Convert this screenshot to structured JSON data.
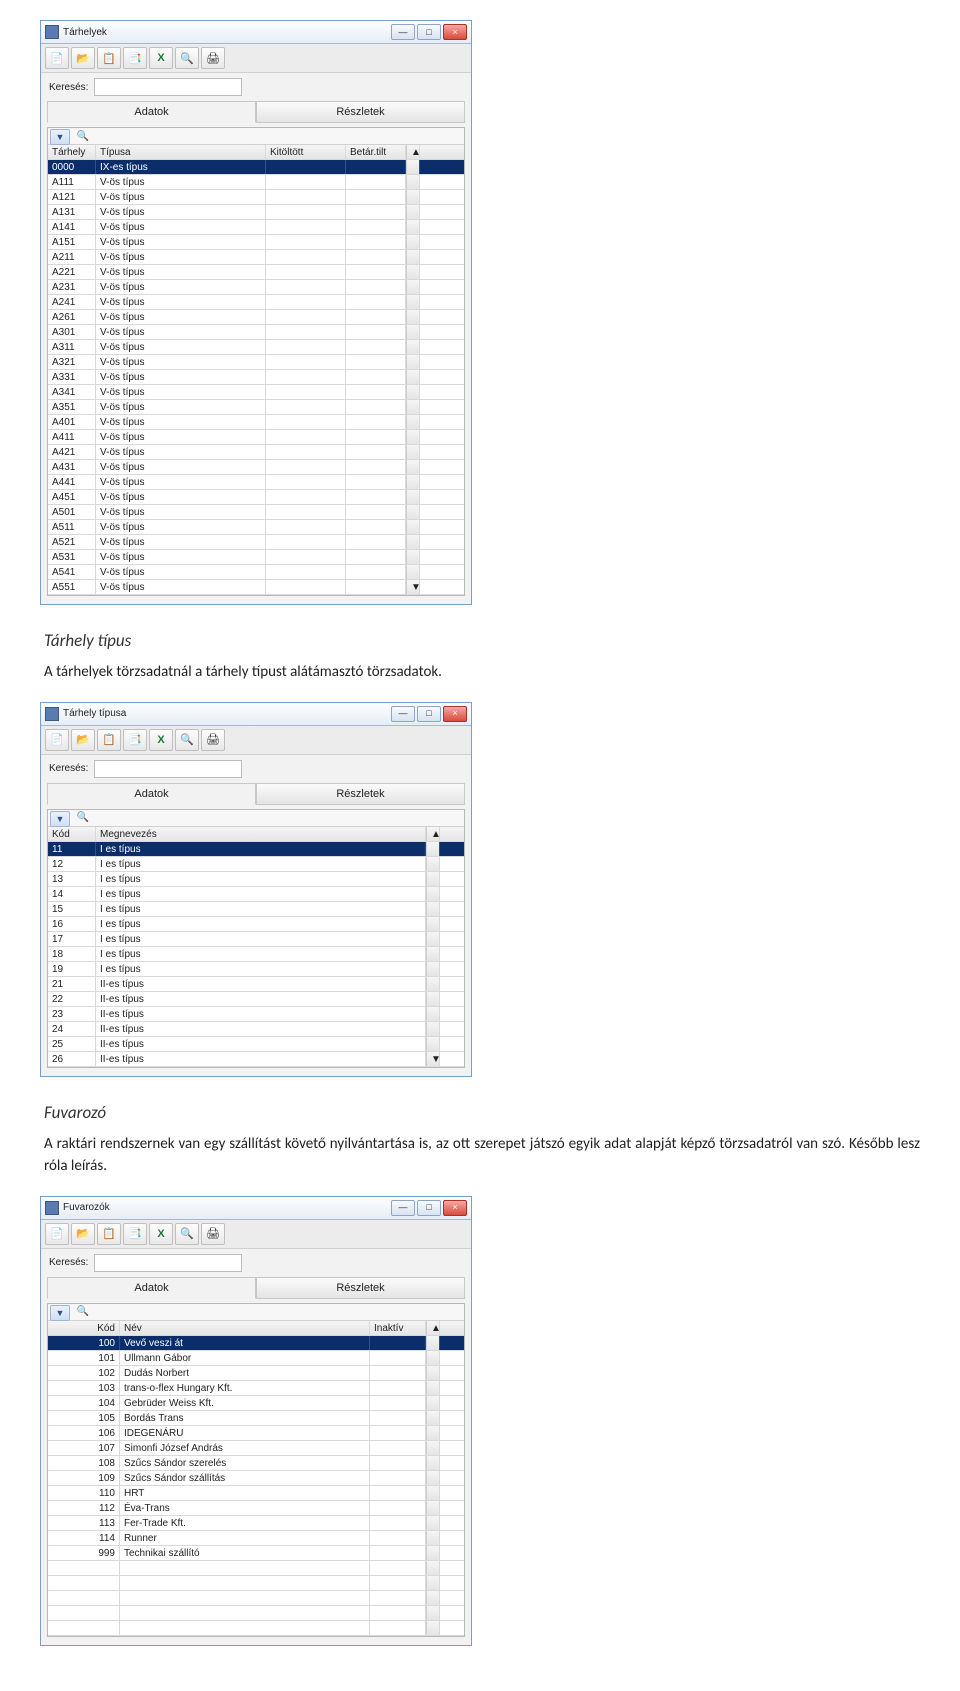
{
  "section1": {
    "heading": "Tárhely típus",
    "body": "A tárhelyek törzsadatnál a tárhely típust alátámasztó törzsadatok."
  },
  "section2": {
    "heading": "Fuvarozó",
    "body": "A raktári rendszernek van egy szállítást követő nyilvántartása is, az ott szerepet játszó egyik adat alapját képző törzsadatról van szó. Később lesz róla leírás."
  },
  "common": {
    "search_label": "Keresés:",
    "tab_data": "Adatok",
    "tab_details": "Részletek",
    "min_sym": "—",
    "max_sym": "□",
    "close_sym": "×",
    "filter_sym": "▼",
    "scroll_up": "▲",
    "scroll_down": "▼"
  },
  "win1": {
    "title": "Tárhelyek",
    "columns": {
      "c1": "Tárhely",
      "c2": "Típusa",
      "c3": "Kitöltött",
      "c4": "Betár.tilt"
    },
    "rows": [
      {
        "c1": "0000",
        "c2": "IX-es típus",
        "sel": true
      },
      {
        "c1": "A111",
        "c2": "V-ös típus"
      },
      {
        "c1": "A121",
        "c2": "V-ös típus"
      },
      {
        "c1": "A131",
        "c2": "V-ös típus"
      },
      {
        "c1": "A141",
        "c2": "V-ös típus"
      },
      {
        "c1": "A151",
        "c2": "V-ös típus"
      },
      {
        "c1": "A211",
        "c2": "V-ös típus"
      },
      {
        "c1": "A221",
        "c2": "V-ös típus"
      },
      {
        "c1": "A231",
        "c2": "V-ös típus"
      },
      {
        "c1": "A241",
        "c2": "V-ös típus"
      },
      {
        "c1": "A261",
        "c2": "V-ös típus"
      },
      {
        "c1": "A301",
        "c2": "V-ös típus"
      },
      {
        "c1": "A311",
        "c2": "V-ös típus"
      },
      {
        "c1": "A321",
        "c2": "V-ös típus"
      },
      {
        "c1": "A331",
        "c2": "V-ös típus"
      },
      {
        "c1": "A341",
        "c2": "V-ös típus"
      },
      {
        "c1": "A351",
        "c2": "V-ös típus"
      },
      {
        "c1": "A401",
        "c2": "V-ös típus"
      },
      {
        "c1": "A411",
        "c2": "V-ös típus"
      },
      {
        "c1": "A421",
        "c2": "V-ös típus"
      },
      {
        "c1": "A431",
        "c2": "V-ös típus"
      },
      {
        "c1": "A441",
        "c2": "V-ös típus"
      },
      {
        "c1": "A451",
        "c2": "V-ös típus"
      },
      {
        "c1": "A501",
        "c2": "V-ös típus"
      },
      {
        "c1": "A511",
        "c2": "V-ös típus"
      },
      {
        "c1": "A521",
        "c2": "V-ös típus"
      },
      {
        "c1": "A531",
        "c2": "V-ös típus"
      },
      {
        "c1": "A541",
        "c2": "V-ös típus"
      },
      {
        "c1": "A551",
        "c2": "V-ös típus"
      }
    ]
  },
  "win2": {
    "title": "Tárhely típusa",
    "columns": {
      "c1": "Kód",
      "c2": "Megnevezés"
    },
    "rows": [
      {
        "c1": "11",
        "c2": "I es típus",
        "sel": true
      },
      {
        "c1": "12",
        "c2": "I es típus"
      },
      {
        "c1": "13",
        "c2": "I es típus"
      },
      {
        "c1": "14",
        "c2": "I es típus"
      },
      {
        "c1": "15",
        "c2": "I es típus"
      },
      {
        "c1": "16",
        "c2": "I es típus"
      },
      {
        "c1": "17",
        "c2": "I es típus"
      },
      {
        "c1": "18",
        "c2": "I es típus"
      },
      {
        "c1": "19",
        "c2": "I es típus"
      },
      {
        "c1": "21",
        "c2": "II-es típus"
      },
      {
        "c1": "22",
        "c2": "II-es típus"
      },
      {
        "c1": "23",
        "c2": "II-es típus"
      },
      {
        "c1": "24",
        "c2": "II-es típus"
      },
      {
        "c1": "25",
        "c2": "II-es típus"
      },
      {
        "c1": "26",
        "c2": "II-es típus"
      }
    ]
  },
  "win3": {
    "title": "Fuvarozók",
    "columns": {
      "c1": "Kód",
      "c2": "Név",
      "c3": "Inaktív"
    },
    "rows": [
      {
        "c1": "100",
        "c2": "Vevő veszi át",
        "sel": true
      },
      {
        "c1": "101",
        "c2": "Ullmann Gábor"
      },
      {
        "c1": "102",
        "c2": "Dudás Norbert"
      },
      {
        "c1": "103",
        "c2": "trans-o-flex Hungary Kft."
      },
      {
        "c1": "104",
        "c2": "Gebrüder Weiss Kft."
      },
      {
        "c1": "105",
        "c2": "Bordás Trans"
      },
      {
        "c1": "106",
        "c2": "IDEGENÁRU"
      },
      {
        "c1": "107",
        "c2": "Simonfi József András"
      },
      {
        "c1": "108",
        "c2": "Szűcs Sándor szerelés"
      },
      {
        "c1": "109",
        "c2": "Szűcs Sándor szállítás"
      },
      {
        "c1": "110",
        "c2": "HRT"
      },
      {
        "c1": "112",
        "c2": "Éva-Trans"
      },
      {
        "c1": "113",
        "c2": "Fer-Trade Kft."
      },
      {
        "c1": "114",
        "c2": "Runner"
      },
      {
        "c1": "999",
        "c2": "Technikai szállító"
      }
    ],
    "blank_rows": 5
  },
  "toolbar_icons": [
    "📄",
    "📂",
    "📋",
    "📑",
    "X",
    "🔍",
    "🖨"
  ]
}
